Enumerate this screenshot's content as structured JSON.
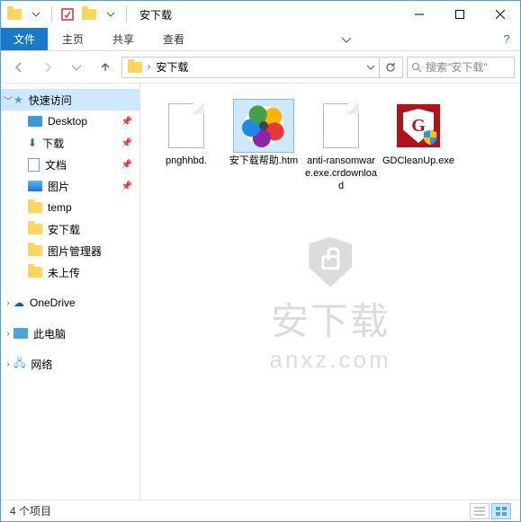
{
  "title": "安下载",
  "ribbon": {
    "file": "文件",
    "home": "主页",
    "share": "共享",
    "view": "查看"
  },
  "address": {
    "folder": "安下载"
  },
  "search": {
    "placeholder": "搜索\"安下载\""
  },
  "sidebar": {
    "quick_access": "快速访问",
    "items": [
      {
        "label": "Desktop",
        "pinned": true
      },
      {
        "label": "下载",
        "pinned": true
      },
      {
        "label": "文档",
        "pinned": true
      },
      {
        "label": "图片",
        "pinned": true
      },
      {
        "label": "temp",
        "pinned": false
      },
      {
        "label": "安下载",
        "pinned": false
      },
      {
        "label": "图片管理器",
        "pinned": false
      },
      {
        "label": "未上传",
        "pinned": false
      }
    ],
    "onedrive": "OneDrive",
    "thispc": "此电脑",
    "network": "网络"
  },
  "files": [
    {
      "name": "pnghhbd.",
      "kind": "blank"
    },
    {
      "name": "安下载帮助.htm",
      "kind": "pinwheel",
      "selected": true
    },
    {
      "name": "anti-ransomware.exe.crdownload",
      "kind": "blank"
    },
    {
      "name": "GDCleanUp.exe",
      "kind": "gshield"
    }
  ],
  "status": {
    "count_label": "4 个项目"
  },
  "watermark": {
    "text": "安下载",
    "url": "anxz.com"
  }
}
